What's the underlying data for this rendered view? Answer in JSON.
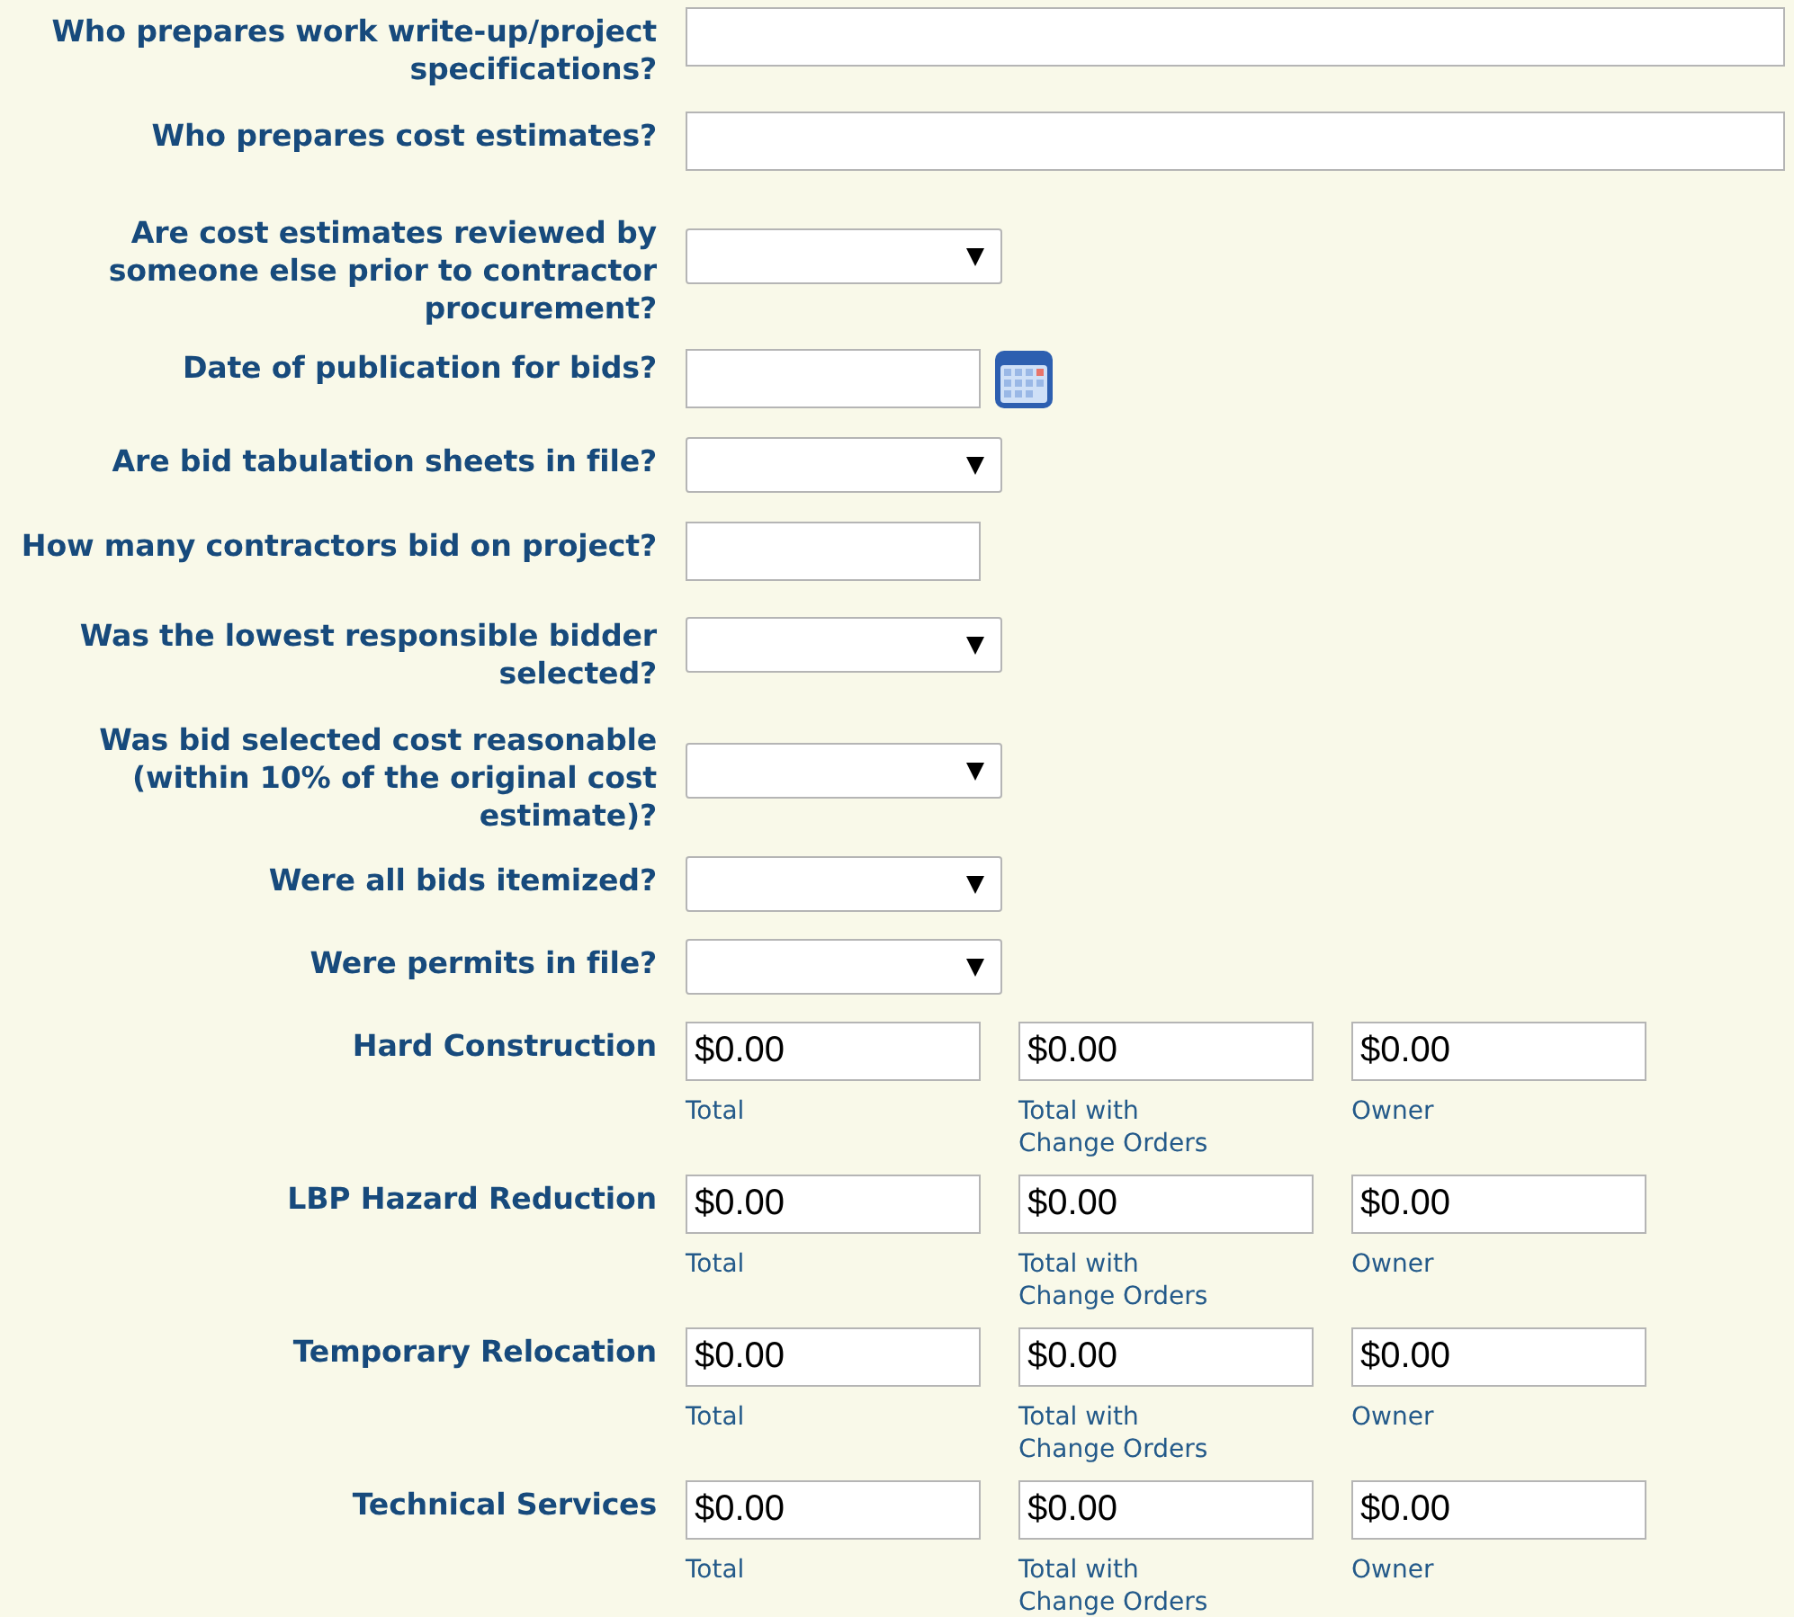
{
  "fields": [
    {
      "kind": "text",
      "label": "Who prepares work write-up/project specifications?"
    },
    {
      "kind": "text",
      "label": "Who prepares cost estimates?"
    },
    {
      "kind": "select",
      "label": "Are cost estimates reviewed by someone else prior to contractor procurement?"
    },
    {
      "kind": "date",
      "label": "Date of publication for bids?"
    },
    {
      "kind": "select",
      "label": "Are bid tabulation sheets in file?"
    },
    {
      "kind": "short",
      "label": "How many contractors bid on project?"
    },
    {
      "kind": "select",
      "label": "Was the lowest responsible bidder selected?"
    },
    {
      "kind": "select",
      "label": "Was bid selected cost reasonable (within 10% of the original cost estimate)?"
    },
    {
      "kind": "select",
      "label": "Were all bids itemized?"
    },
    {
      "kind": "select",
      "label": "Were permits in file?"
    },
    {
      "kind": "money",
      "label": "Hard Construction",
      "amounts": [
        {
          "value": "$0.00",
          "caption": "Total"
        },
        {
          "value": "$0.00",
          "caption": "Total with Change Orders"
        },
        {
          "value": "$0.00",
          "caption": "Owner"
        }
      ]
    },
    {
      "kind": "money",
      "label": "LBP Hazard Reduction",
      "amounts": [
        {
          "value": "$0.00",
          "caption": "Total"
        },
        {
          "value": "$0.00",
          "caption": "Total with Change Orders"
        },
        {
          "value": "$0.00",
          "caption": "Owner"
        }
      ]
    },
    {
      "kind": "money",
      "label": "Temporary Relocation",
      "amounts": [
        {
          "value": "$0.00",
          "caption": "Total"
        },
        {
          "value": "$0.00",
          "caption": "Total with Change Orders"
        },
        {
          "value": "$0.00",
          "caption": "Owner"
        }
      ]
    },
    {
      "kind": "money",
      "label": "Technical Services",
      "amounts": [
        {
          "value": "$0.00",
          "caption": "Total"
        },
        {
          "value": "$0.00",
          "caption": "Total with Change Orders"
        },
        {
          "value": "$0.00",
          "caption": "Owner"
        }
      ]
    }
  ]
}
